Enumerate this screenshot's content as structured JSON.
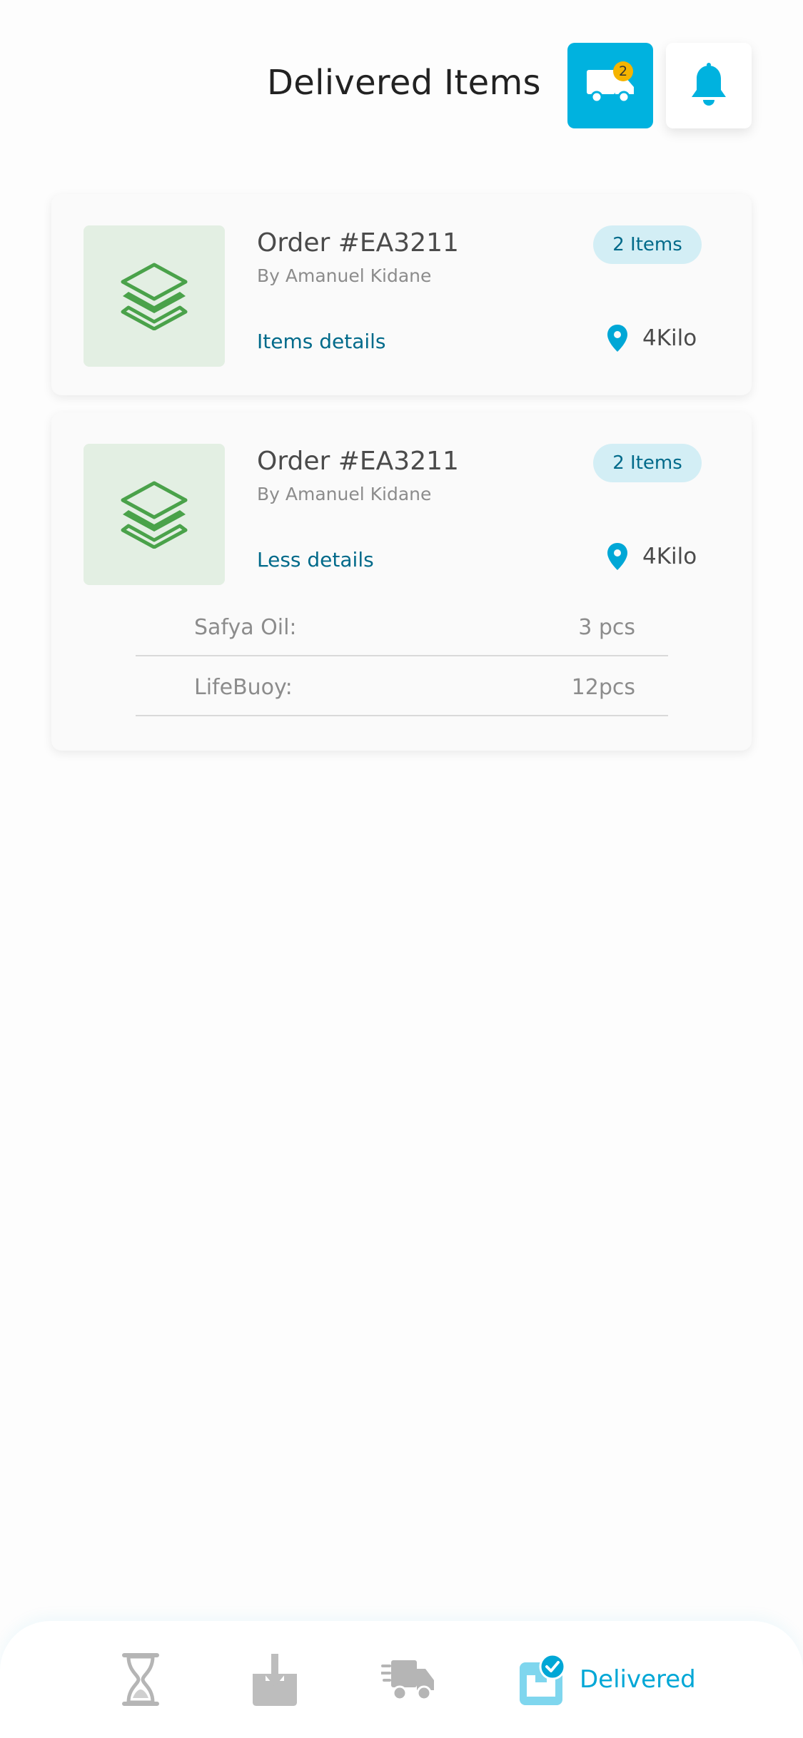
{
  "header": {
    "title": "Delivered Items",
    "truck_badge_count": "2"
  },
  "colors": {
    "accent": "#00b2df",
    "link": "#006a8a",
    "badge_bg": "#d3eef5",
    "thumb_bg": "#e3efe3",
    "layers_green": "#4aa24a",
    "notification_badge": "#f5b400"
  },
  "orders": [
    {
      "title": "Order #EA3211",
      "by": "By Amanuel Kidane",
      "items_badge": "2 Items",
      "details_link": "Items details",
      "location": "4Kilo",
      "expanded": false
    },
    {
      "title": "Order #EA3211",
      "by": "By Amanuel Kidane",
      "items_badge": "2 Items",
      "details_link": "Less details",
      "location": "4Kilo",
      "expanded": true,
      "items": [
        {
          "name": "Safya Oil:",
          "qty": "3 pcs"
        },
        {
          "name": "LifeBuoy:",
          "qty": "12pcs"
        }
      ]
    }
  ],
  "bottom_nav": {
    "items": [
      {
        "icon": "hourglass-icon",
        "active": false
      },
      {
        "icon": "download-box-icon",
        "active": false
      },
      {
        "icon": "fast-truck-icon",
        "active": false
      },
      {
        "icon": "delivered-box-icon",
        "active": true,
        "label": "Delivered"
      }
    ]
  }
}
